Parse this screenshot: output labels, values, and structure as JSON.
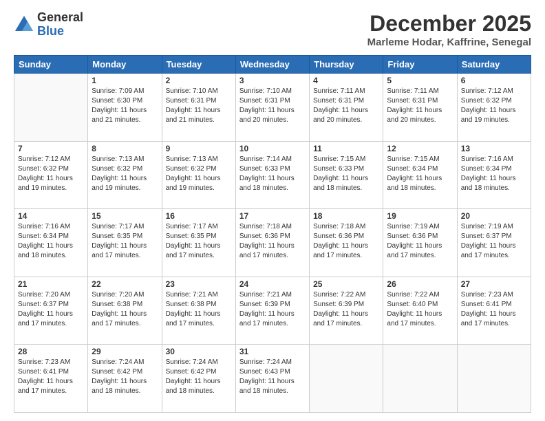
{
  "logo": {
    "general": "General",
    "blue": "Blue"
  },
  "header": {
    "month": "December 2025",
    "location": "Marleme Hodar, Kaffrine, Senegal"
  },
  "weekdays": [
    "Sunday",
    "Monday",
    "Tuesday",
    "Wednesday",
    "Thursday",
    "Friday",
    "Saturday"
  ],
  "weeks": [
    [
      {
        "day": "",
        "info": ""
      },
      {
        "day": "1",
        "info": "Sunrise: 7:09 AM\nSunset: 6:30 PM\nDaylight: 11 hours\nand 21 minutes."
      },
      {
        "day": "2",
        "info": "Sunrise: 7:10 AM\nSunset: 6:31 PM\nDaylight: 11 hours\nand 21 minutes."
      },
      {
        "day": "3",
        "info": "Sunrise: 7:10 AM\nSunset: 6:31 PM\nDaylight: 11 hours\nand 20 minutes."
      },
      {
        "day": "4",
        "info": "Sunrise: 7:11 AM\nSunset: 6:31 PM\nDaylight: 11 hours\nand 20 minutes."
      },
      {
        "day": "5",
        "info": "Sunrise: 7:11 AM\nSunset: 6:31 PM\nDaylight: 11 hours\nand 20 minutes."
      },
      {
        "day": "6",
        "info": "Sunrise: 7:12 AM\nSunset: 6:32 PM\nDaylight: 11 hours\nand 19 minutes."
      }
    ],
    [
      {
        "day": "7",
        "info": "Sunrise: 7:12 AM\nSunset: 6:32 PM\nDaylight: 11 hours\nand 19 minutes."
      },
      {
        "day": "8",
        "info": "Sunrise: 7:13 AM\nSunset: 6:32 PM\nDaylight: 11 hours\nand 19 minutes."
      },
      {
        "day": "9",
        "info": "Sunrise: 7:13 AM\nSunset: 6:32 PM\nDaylight: 11 hours\nand 19 minutes."
      },
      {
        "day": "10",
        "info": "Sunrise: 7:14 AM\nSunset: 6:33 PM\nDaylight: 11 hours\nand 18 minutes."
      },
      {
        "day": "11",
        "info": "Sunrise: 7:15 AM\nSunset: 6:33 PM\nDaylight: 11 hours\nand 18 minutes."
      },
      {
        "day": "12",
        "info": "Sunrise: 7:15 AM\nSunset: 6:34 PM\nDaylight: 11 hours\nand 18 minutes."
      },
      {
        "day": "13",
        "info": "Sunrise: 7:16 AM\nSunset: 6:34 PM\nDaylight: 11 hours\nand 18 minutes."
      }
    ],
    [
      {
        "day": "14",
        "info": "Sunrise: 7:16 AM\nSunset: 6:34 PM\nDaylight: 11 hours\nand 18 minutes."
      },
      {
        "day": "15",
        "info": "Sunrise: 7:17 AM\nSunset: 6:35 PM\nDaylight: 11 hours\nand 17 minutes."
      },
      {
        "day": "16",
        "info": "Sunrise: 7:17 AM\nSunset: 6:35 PM\nDaylight: 11 hours\nand 17 minutes."
      },
      {
        "day": "17",
        "info": "Sunrise: 7:18 AM\nSunset: 6:36 PM\nDaylight: 11 hours\nand 17 minutes."
      },
      {
        "day": "18",
        "info": "Sunrise: 7:18 AM\nSunset: 6:36 PM\nDaylight: 11 hours\nand 17 minutes."
      },
      {
        "day": "19",
        "info": "Sunrise: 7:19 AM\nSunset: 6:36 PM\nDaylight: 11 hours\nand 17 minutes."
      },
      {
        "day": "20",
        "info": "Sunrise: 7:19 AM\nSunset: 6:37 PM\nDaylight: 11 hours\nand 17 minutes."
      }
    ],
    [
      {
        "day": "21",
        "info": "Sunrise: 7:20 AM\nSunset: 6:37 PM\nDaylight: 11 hours\nand 17 minutes."
      },
      {
        "day": "22",
        "info": "Sunrise: 7:20 AM\nSunset: 6:38 PM\nDaylight: 11 hours\nand 17 minutes."
      },
      {
        "day": "23",
        "info": "Sunrise: 7:21 AM\nSunset: 6:38 PM\nDaylight: 11 hours\nand 17 minutes."
      },
      {
        "day": "24",
        "info": "Sunrise: 7:21 AM\nSunset: 6:39 PM\nDaylight: 11 hours\nand 17 minutes."
      },
      {
        "day": "25",
        "info": "Sunrise: 7:22 AM\nSunset: 6:39 PM\nDaylight: 11 hours\nand 17 minutes."
      },
      {
        "day": "26",
        "info": "Sunrise: 7:22 AM\nSunset: 6:40 PM\nDaylight: 11 hours\nand 17 minutes."
      },
      {
        "day": "27",
        "info": "Sunrise: 7:23 AM\nSunset: 6:41 PM\nDaylight: 11 hours\nand 17 minutes."
      }
    ],
    [
      {
        "day": "28",
        "info": "Sunrise: 7:23 AM\nSunset: 6:41 PM\nDaylight: 11 hours\nand 17 minutes."
      },
      {
        "day": "29",
        "info": "Sunrise: 7:24 AM\nSunset: 6:42 PM\nDaylight: 11 hours\nand 18 minutes."
      },
      {
        "day": "30",
        "info": "Sunrise: 7:24 AM\nSunset: 6:42 PM\nDaylight: 11 hours\nand 18 minutes."
      },
      {
        "day": "31",
        "info": "Sunrise: 7:24 AM\nSunset: 6:43 PM\nDaylight: 11 hours\nand 18 minutes."
      },
      {
        "day": "",
        "info": ""
      },
      {
        "day": "",
        "info": ""
      },
      {
        "day": "",
        "info": ""
      }
    ]
  ]
}
